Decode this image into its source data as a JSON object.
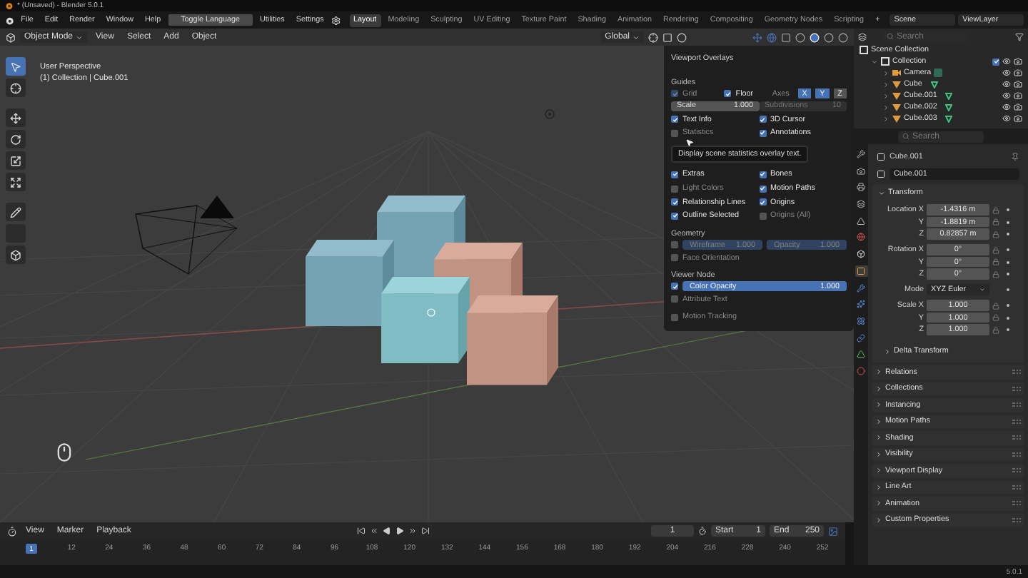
{
  "window": {
    "title": "* (Unsaved) - Blender 5.0.1"
  },
  "topbar": {
    "menus": [
      "File",
      "Edit",
      "Render",
      "Window",
      "Help"
    ],
    "toggle_button": "Toggle Language",
    "extra_menus": [
      "Utilities",
      "Settings"
    ],
    "workspaces": [
      {
        "label": "Layout",
        "selected": true
      },
      {
        "label": "Modeling",
        "selected": false
      },
      {
        "label": "Sculpting",
        "selected": false
      },
      {
        "label": "UV Editing",
        "selected": false
      },
      {
        "label": "Texture Paint",
        "selected": false
      },
      {
        "label": "Shading",
        "selected": false
      },
      {
        "label": "Animation",
        "selected": false
      },
      {
        "label": "Rendering",
        "selected": false
      },
      {
        "label": "Compositing",
        "selected": false
      },
      {
        "label": "Geometry Nodes",
        "selected": false
      },
      {
        "label": "Scripting",
        "selected": false
      }
    ],
    "add_tab": "+",
    "scene": "Scene",
    "view_layer": "ViewLayer"
  },
  "viewport": {
    "mode": "Object Mode",
    "menus": [
      "View",
      "Select",
      "Add",
      "Object"
    ],
    "orientation": "Global",
    "tools": [
      {
        "kind": "select",
        "selected": true
      },
      {
        "kind": "cursor",
        "selected": false
      },
      {
        "kind": "move",
        "selected": false
      },
      {
        "kind": "rotate",
        "selected": false
      },
      {
        "kind": "scale",
        "selected": false
      },
      {
        "kind": "transform",
        "selected": false
      },
      {
        "kind": "annotate",
        "selected": false
      },
      {
        "kind": "measure",
        "selected": false
      },
      {
        "kind": "add_cube",
        "selected": false
      }
    ],
    "info": [
      "User Perspective",
      "(1) Collection | Cube.001"
    ]
  },
  "overlays": {
    "title": "Viewport Overlays",
    "guides": {
      "heading": "Guides",
      "grid": {
        "label": "Grid",
        "checked": true,
        "disabled": true
      },
      "floor": {
        "label": "Floor",
        "checked": true
      },
      "axes_label": "Axes",
      "axes": [
        {
          "label": "X",
          "selected": true
        },
        {
          "label": "Y",
          "selected": true
        },
        {
          "label": "Z",
          "selected": false
        }
      ],
      "scale": {
        "label": "Scale",
        "value": "1.000"
      },
      "subdivisions": {
        "label": "Subdivisions",
        "value": "10",
        "disabled": true
      }
    },
    "options": [
      {
        "label": "Text Info",
        "checked": true
      },
      {
        "label": "3D Cursor",
        "checked": true
      },
      {
        "label": "Statistics",
        "checked": false
      },
      {
        "label": "Annotations",
        "checked": true
      }
    ],
    "tooltip": "Display scene statistics overlay text.",
    "options_2": [
      {
        "label": "Extras",
        "checked": true
      },
      {
        "label": "Bones",
        "checked": true
      },
      {
        "label": "Light Colors",
        "checked": false
      },
      {
        "label": "Motion Paths",
        "checked": true
      },
      {
        "label": "Relationship Lines",
        "checked": true
      },
      {
        "label": "Origins",
        "checked": true
      },
      {
        "label": "Outline Selected",
        "checked": true
      },
      {
        "label": "Origins (All)",
        "checked": false
      }
    ],
    "geometry": {
      "heading": "Geometry",
      "wireframe_checked": false,
      "sliders": [
        {
          "label": "Wireframe",
          "value": "1.000",
          "level": 1,
          "disabled": true
        },
        {
          "label": "Opacity",
          "value": "1.000",
          "level": 1,
          "disabled": true
        }
      ],
      "face_orientation": {
        "label": "Face Orientation",
        "checked": false
      }
    },
    "viewer_node": {
      "heading": "Viewer Node",
      "color_checked": true,
      "slider": {
        "label": "Color Opacity",
        "value": "1.000",
        "level": 1,
        "disabled": false
      },
      "attribute_text": {
        "label": "Attribute Text",
        "checked": false
      }
    },
    "motion_tracking": {
      "label": "Motion Tracking",
      "checked": false
    }
  },
  "outliner": {
    "search_placeholder": "Search",
    "tree": [
      {
        "label": "Scene Collection",
        "kind": "scene",
        "children": [
          {
            "label": "Collection",
            "kind": "collection",
            "expanded": true,
            "checked": true,
            "children": [
              {
                "label": "Camera",
                "kind": "camera",
                "expanded": false
              },
              {
                "label": "Cube",
                "kind": "mesh",
                "expanded": false
              },
              {
                "label": "Cube.001",
                "kind": "mesh",
                "expanded": false
              },
              {
                "label": "Cube.002",
                "kind": "mesh",
                "expanded": false
              },
              {
                "label": "Cube.003",
                "kind": "mesh",
                "expanded": false
              }
            ]
          }
        ]
      }
    ]
  },
  "properties": {
    "search_placeholder": "Search",
    "tabs": [
      {
        "kind": "tool",
        "selected": false
      },
      {
        "kind": "render",
        "selected": false
      },
      {
        "kind": "output",
        "selected": false
      },
      {
        "kind": "view_layer",
        "selected": false
      },
      {
        "kind": "scene",
        "selected": false
      },
      {
        "kind": "world",
        "selected": false
      },
      {
        "kind": "collection",
        "selected": false
      },
      {
        "kind": "object",
        "selected": true
      },
      {
        "kind": "modifiers",
        "selected": false
      },
      {
        "kind": "particles",
        "selected": false
      },
      {
        "kind": "physics",
        "selected": false
      },
      {
        "kind": "constraints",
        "selected": false
      },
      {
        "kind": "data",
        "selected": false
      },
      {
        "kind": "material",
        "selected": false
      }
    ],
    "object_name": "Cube.001",
    "name_field": "Cube.001",
    "transform": {
      "title": "Transform",
      "expanded": true,
      "groups": [
        [
          {
            "label": "Location X",
            "value": "-1.4316 m",
            "kind": "number"
          },
          {
            "label": "Y",
            "value": "-1.8819 m",
            "kind": "number"
          },
          {
            "label": "Z",
            "value": "0.82857 m",
            "kind": "number"
          }
        ],
        [
          {
            "label": "Rotation X",
            "value": "0°",
            "kind": "number"
          },
          {
            "label": "Y",
            "value": "0°",
            "kind": "number"
          },
          {
            "label": "Z",
            "value": "0°",
            "kind": "number"
          }
        ],
        [
          {
            "label": "Mode",
            "value": "XYZ Euler",
            "kind": "dropdown"
          }
        ],
        [
          {
            "label": "Scale X",
            "value": "1.000",
            "kind": "number"
          },
          {
            "label": "Y",
            "value": "1.000",
            "kind": "number"
          },
          {
            "label": "Z",
            "value": "1.000",
            "kind": "number"
          }
        ]
      ],
      "subpanel": "Delta Transform"
    },
    "panels": [
      "Relations",
      "Collections",
      "Instancing",
      "Motion Paths",
      "Shading",
      "Visibility",
      "Viewport Display",
      "Line Art",
      "Animation",
      "Custom Properties"
    ]
  },
  "timeline": {
    "menus": [
      "View",
      "Marker",
      "Playback"
    ],
    "current_frame": "1",
    "start_label": "Start",
    "start": "1",
    "end_label": "End",
    "end": "250",
    "playhead": "1",
    "ticks": [
      "12",
      "24",
      "36",
      "48",
      "60",
      "72",
      "84",
      "96",
      "108",
      "120",
      "132",
      "144",
      "156",
      "168",
      "180",
      "192",
      "204",
      "216",
      "228",
      "240",
      "252"
    ]
  },
  "status_bar": {
    "version": "5.0.1"
  }
}
